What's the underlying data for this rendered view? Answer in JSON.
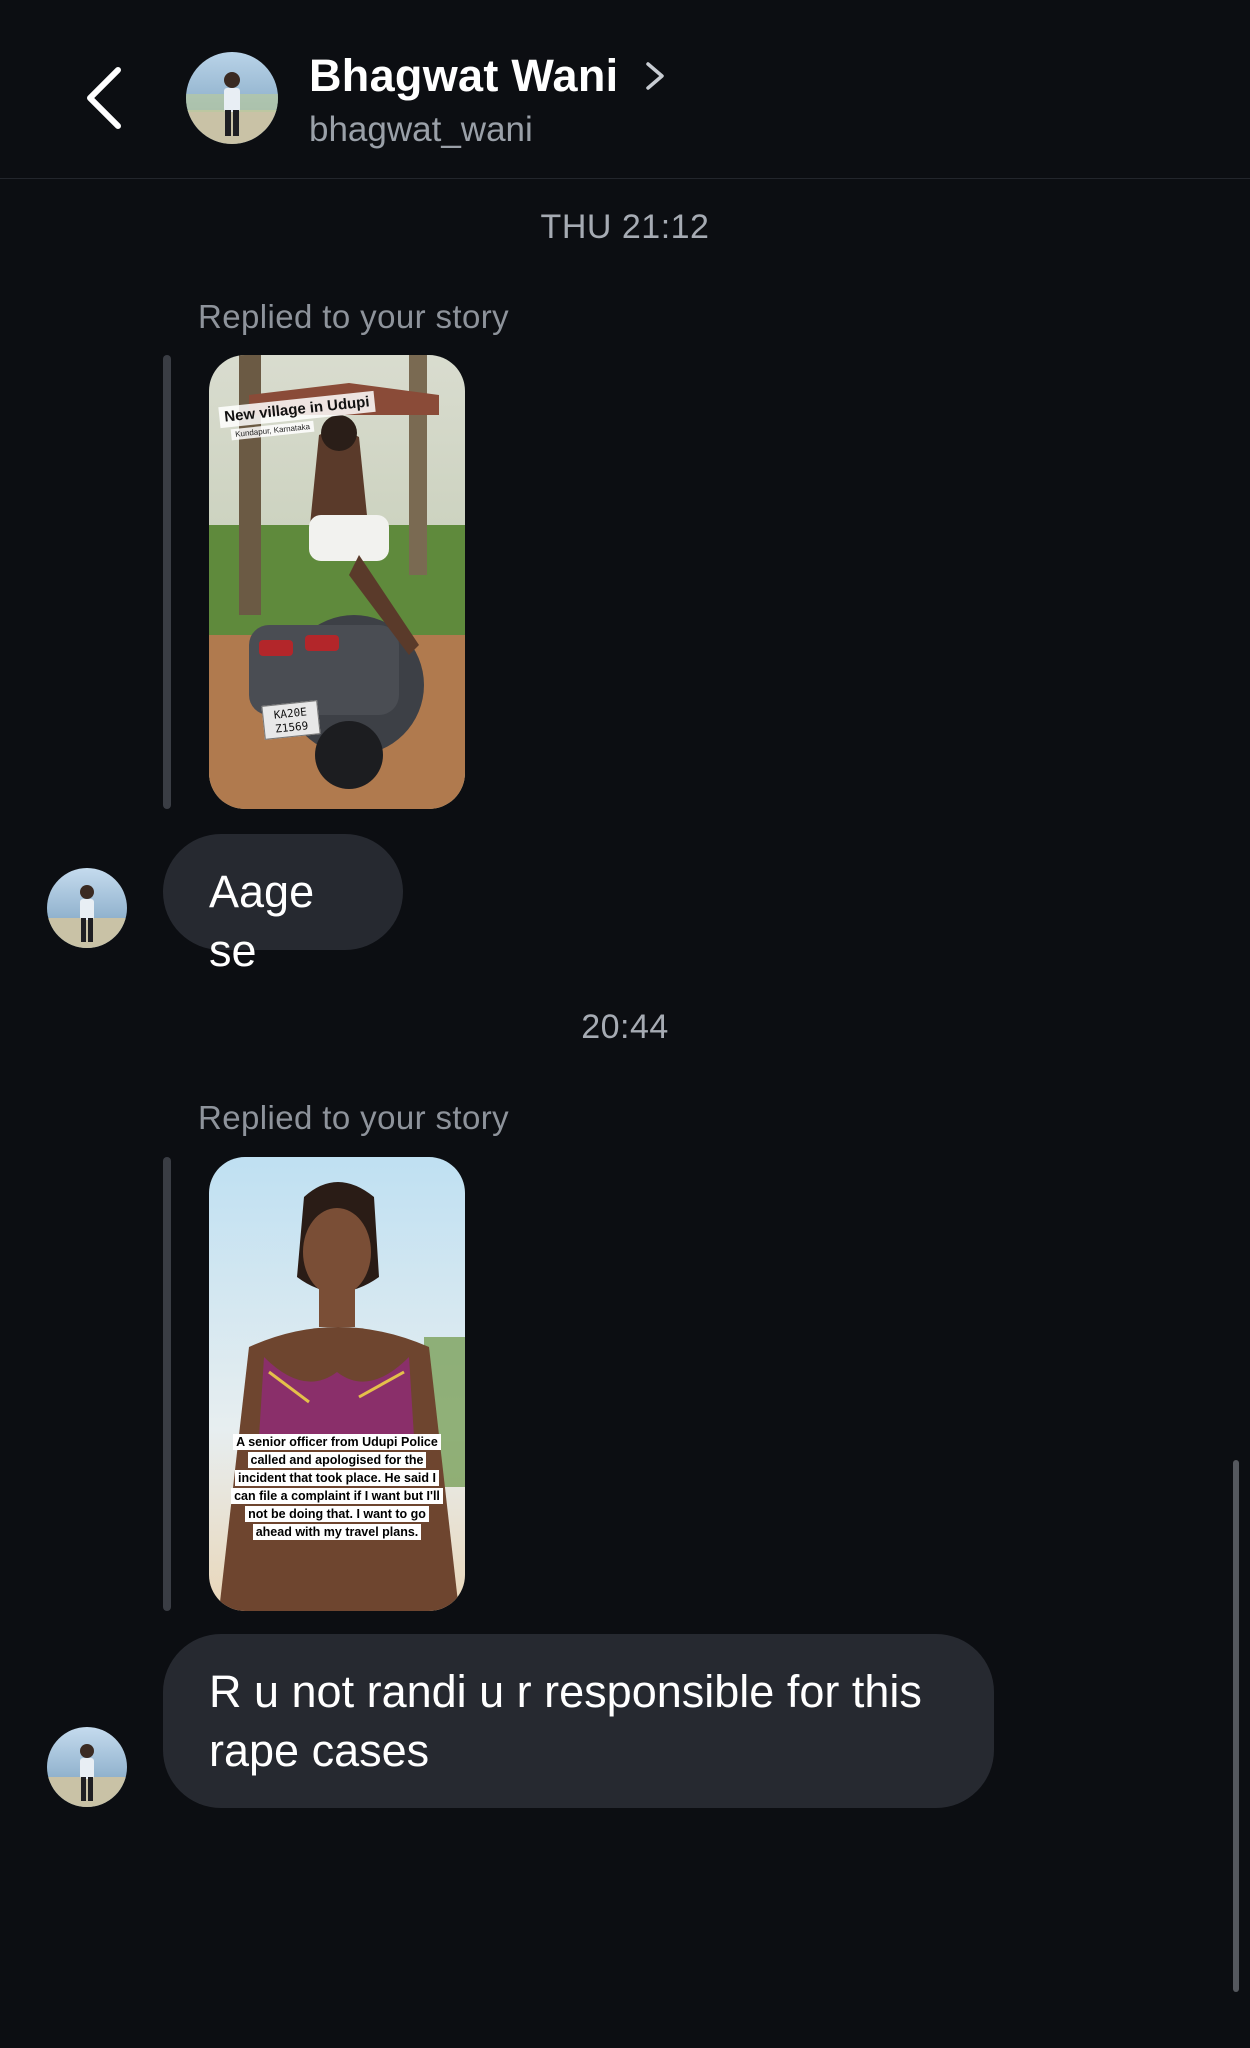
{
  "header": {
    "back_icon": "chevron-left-icon",
    "contact_name": "Bhagwat Wani",
    "contact_username": "bhagwat_wani",
    "name_chevron_icon": "chevron-right-icon"
  },
  "thread": {
    "groups": [
      {
        "timestamp": "THU 21:12",
        "reply_label": "Replied to your story",
        "story": {
          "caption": "New village in Udupi",
          "location": "Kundapur, Karnataka",
          "plate": "KA20E Z1569"
        },
        "message": "Aage se"
      },
      {
        "timestamp": "20:44",
        "reply_label": "Replied to your story",
        "story": {
          "sticker_text": "A senior officer from Udupi Police called and apologised for the incident that took place. He said I can file a complaint if I want but I'll not be doing that. I want to go ahead with my travel plans."
        },
        "message": "R u not randi u r responsible for this rape cases"
      }
    ]
  },
  "colors": {
    "background": "#0c0e12",
    "bubble": "#262930",
    "secondary_text": "#9aa0a8"
  }
}
